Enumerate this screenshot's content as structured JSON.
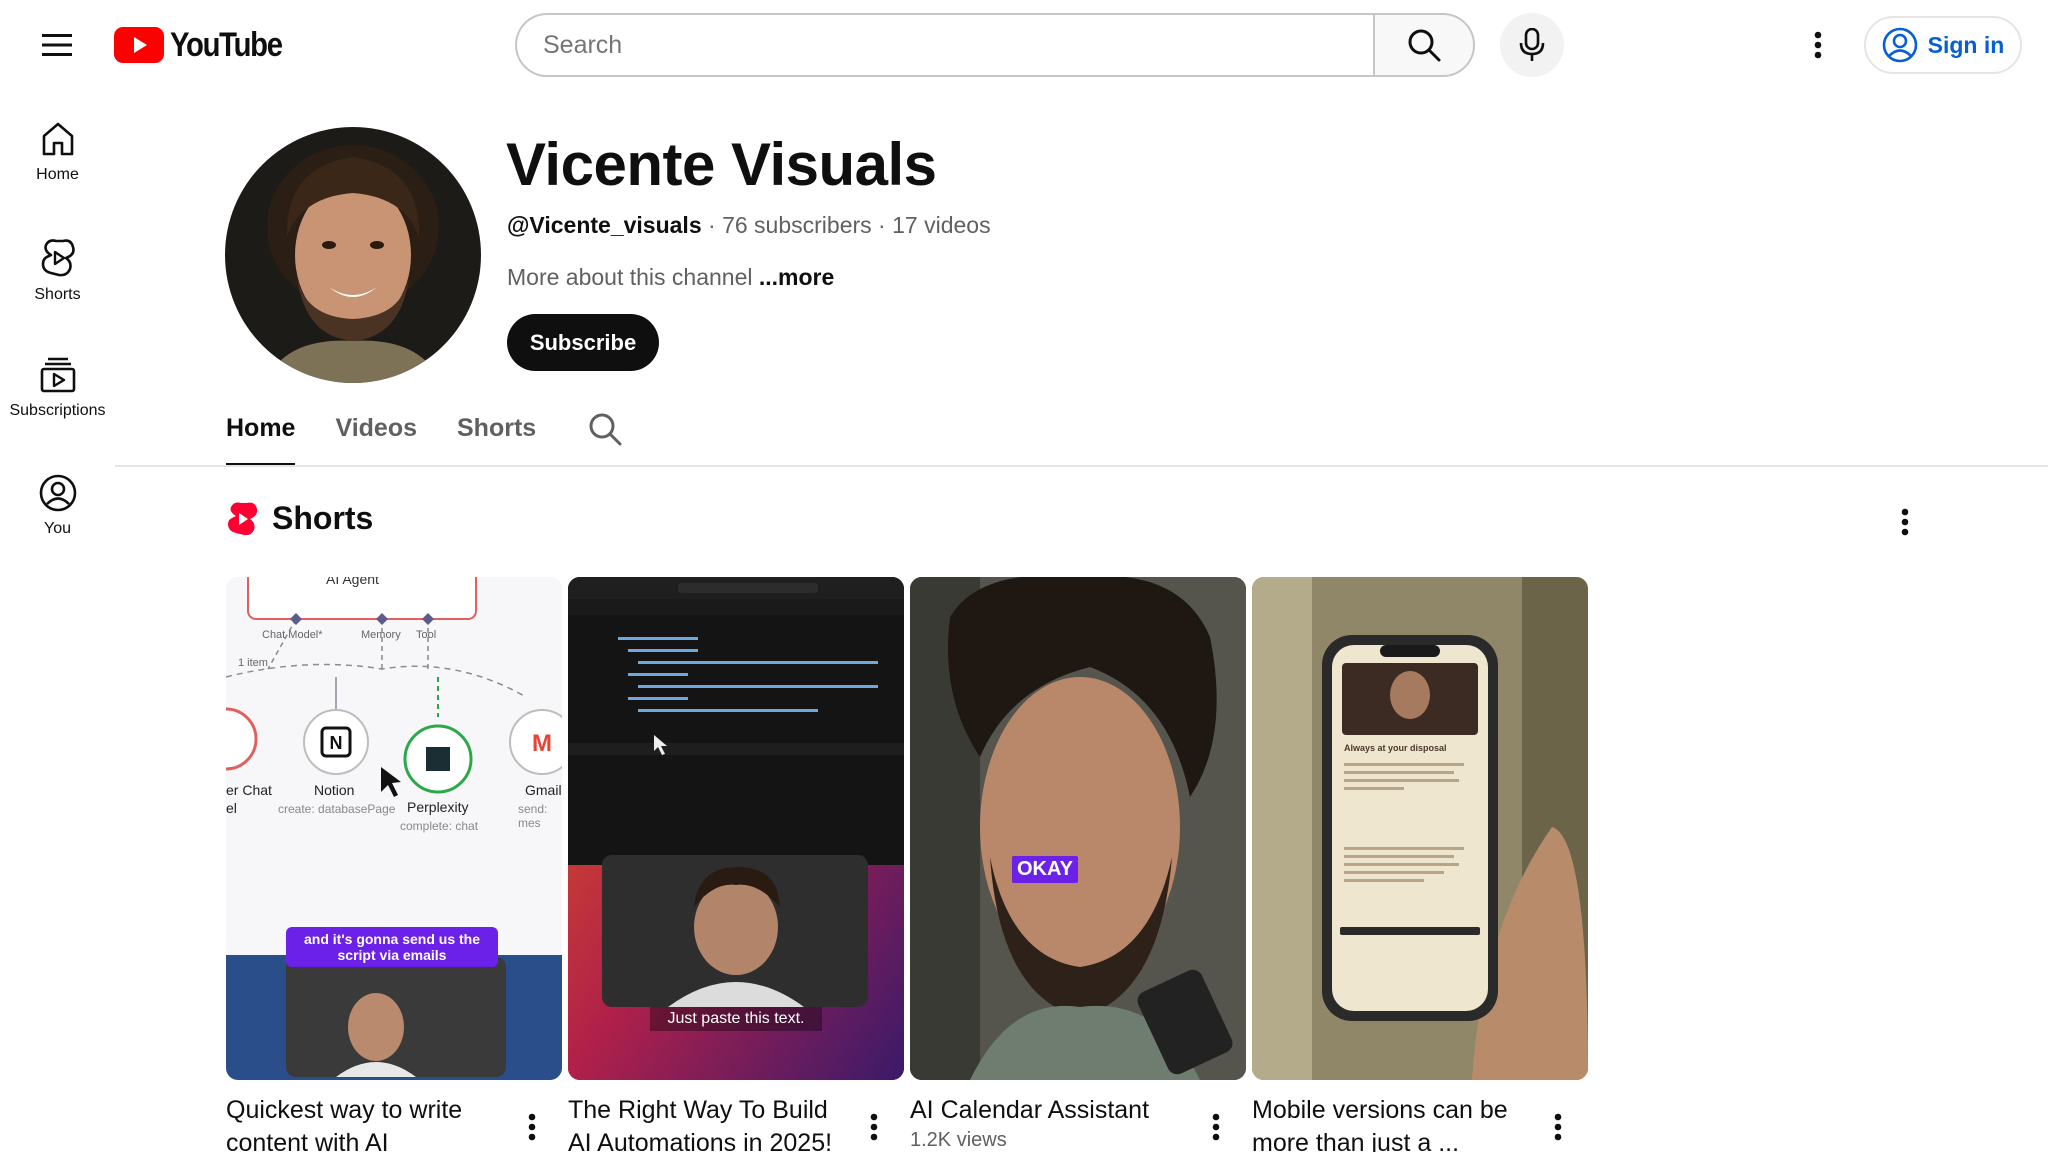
{
  "header": {
    "logo_text": "YouTube",
    "search_placeholder": "Search",
    "signin_label": "Sign in",
    "brand_red": "#ff0000",
    "link_blue": "#065fd4"
  },
  "sidebar": {
    "items": [
      {
        "label": "Home",
        "icon": "home-icon"
      },
      {
        "label": "Shorts",
        "icon": "shorts-icon"
      },
      {
        "label": "Subscriptions",
        "icon": "subscriptions-icon"
      },
      {
        "label": "You",
        "icon": "you-icon"
      }
    ]
  },
  "channel": {
    "name": "Vicente Visuals",
    "handle": "@Vicente_visuals",
    "subscribers": "76 subscribers",
    "videos": "17 videos",
    "about": "More about this channel",
    "more_label": "...more",
    "subscribe_label": "Subscribe"
  },
  "tabs": [
    {
      "label": "Home",
      "active": true
    },
    {
      "label": "Videos",
      "active": false
    },
    {
      "label": "Shorts",
      "active": false
    }
  ],
  "shorts_section": {
    "title": "Shorts",
    "cards": [
      {
        "title": "Quickest way to write content with AI",
        "views": "",
        "caption": "and it's gonna send us the script via emails",
        "nodes": {
          "chat": "er Chat",
          "chat2": "el",
          "notion": "Notion",
          "notion_sub": "create: databasePage",
          "perplexity": "Perplexity",
          "perplexity_sub": "complete: chat",
          "gmail": "Gmail",
          "gmail_sub": "send: mes",
          "chat_model": "Chat Model*",
          "memory": "Memory",
          "tool": "Tool",
          "item": "1 item",
          "agent": "AI Agent"
        }
      },
      {
        "title": "The Right Way To Build AI Automations in 2025!",
        "views": "",
        "caption": "Just paste this text."
      },
      {
        "title": "AI Calendar Assistant",
        "views": "1.2K views",
        "caption": "OKAY"
      },
      {
        "title": "Mobile versions can be more than just a ...",
        "views": "",
        "caption": "Always at your disposal"
      }
    ]
  }
}
